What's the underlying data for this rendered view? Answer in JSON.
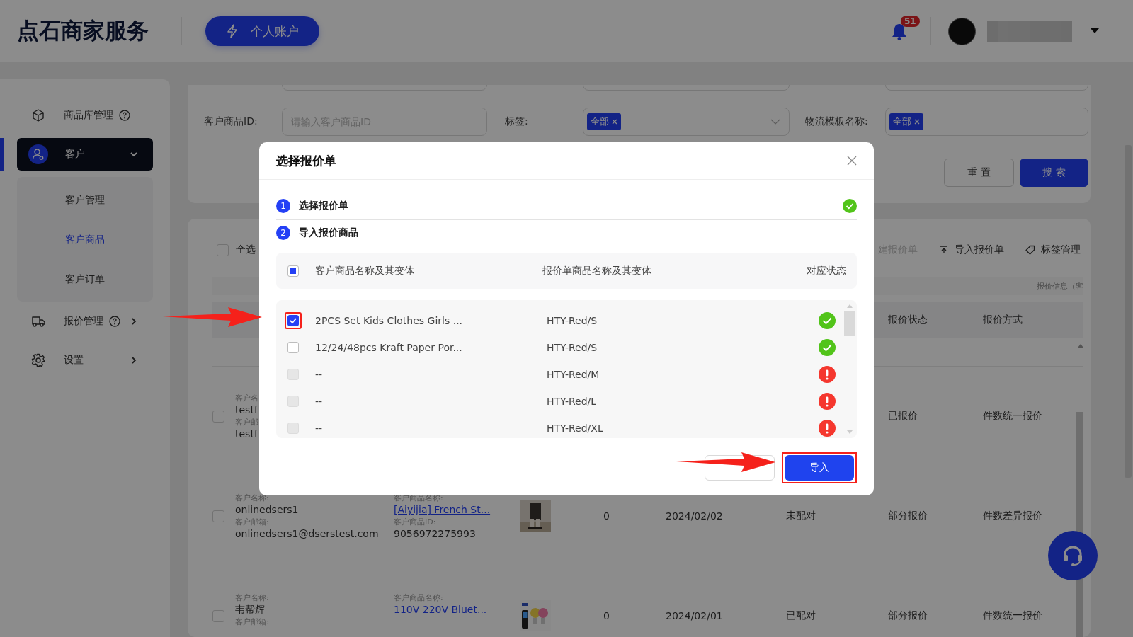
{
  "header": {
    "logo": "点石商家服务",
    "account_button": "个人账户",
    "notifications": {
      "count": "51"
    }
  },
  "sidebar": {
    "items": [
      {
        "label": "商品库管理",
        "help": true,
        "selected": false
      },
      {
        "label": "客户",
        "selected": true,
        "expanded": true,
        "children": [
          {
            "label": "客户管理",
            "selected": false
          },
          {
            "label": "客户商品",
            "selected": true
          },
          {
            "label": "客户订单",
            "selected": false
          }
        ]
      },
      {
        "label": "报价管理",
        "help": true,
        "selected": false,
        "expanded": false
      },
      {
        "label": "设置",
        "selected": false,
        "expanded": false
      }
    ]
  },
  "filters": [
    {
      "kind": "input",
      "label": "客户商品ID:",
      "placeholder": "请输入客户商品ID"
    },
    {
      "kind": "select",
      "label": "标签:",
      "tags": [
        "全部"
      ]
    },
    {
      "kind": "tags",
      "label": "物流模板名称:",
      "tags": [
        "全部"
      ]
    }
  ],
  "filter_buttons": [
    {
      "kind": "default",
      "label": "重 置"
    },
    {
      "kind": "primary",
      "label": "搜 索"
    }
  ],
  "toolbar": {
    "select_all": {
      "label": "全选",
      "checked": false
    },
    "actions": [
      {
        "label": "建报价单",
        "disabled": true
      },
      {
        "label": "导入报价单",
        "disabled": false
      },
      {
        "label": "标签管理",
        "disabled": false
      }
    ]
  },
  "table": {
    "caption": "报价信息（客",
    "columns": [
      "报价状态",
      "报价方式"
    ],
    "rows": [
      {
        "checked": false,
        "customer": {
          "name_label": "客户名",
          "name": "testf",
          "email_label": "客户邮",
          "email": "testf"
        },
        "quote_status": "已报价",
        "quote_method": "件数统一报价"
      },
      {
        "checked": false,
        "customer": {
          "name_label": "客户名称:",
          "name": "onlinedsers1",
          "email_label": "客户邮箱:",
          "email": "onlinedsers1@dserstest.com"
        },
        "product": {
          "name_label": "客户商品名称:",
          "name": "[Aiyijia] French St...",
          "id_label": "客户商品ID:",
          "id": "9056972275993"
        },
        "quantity": "0",
        "date": "2024/02/02",
        "match_status": "未配对",
        "quote_status": "部分报价",
        "quote_method": "件数差异报价"
      },
      {
        "checked": false,
        "customer": {
          "name_label": "客户名称:",
          "name": "韦帮辉",
          "email_label": "客户邮箱:"
        },
        "product": {
          "name_label": "客户商品名称:",
          "name": "110V 220V Bluet..."
        },
        "quantity": "0",
        "date": "2024/02/01",
        "match_status": "已配对",
        "quote_status": "部分报价",
        "quote_method": "件数统一报价"
      }
    ]
  },
  "dialog": {
    "title": "选择报价单",
    "steps": [
      {
        "number": "1",
        "label": "选择报价单",
        "done": true
      },
      {
        "number": "2",
        "label": "导入报价商品",
        "done": false
      }
    ],
    "table": {
      "indeterminate": true,
      "columns": [
        "客户商品名称及其变体",
        "报价单商品名称及其变体",
        "对应状态"
      ],
      "rows": [
        {
          "checked": true,
          "disabled": false,
          "highlighted": true,
          "name": "2PCS Set Kids Clothes Girls ...",
          "quote_item": "HTY-Red/S",
          "kind": "matched"
        },
        {
          "checked": false,
          "disabled": false,
          "highlighted": false,
          "name": "12/24/48pcs Kraft Paper Por...",
          "quote_item": "HTY-Red/S",
          "kind": "matched"
        },
        {
          "checked": false,
          "disabled": true,
          "highlighted": false,
          "name": "--",
          "quote_item": "HTY-Red/M",
          "kind": "unmatched"
        },
        {
          "checked": false,
          "disabled": true,
          "highlighted": false,
          "name": "--",
          "quote_item": "HTY-Red/L",
          "kind": "unmatched"
        },
        {
          "checked": false,
          "disabled": true,
          "highlighted": false,
          "name": "--",
          "quote_item": "HTY-Red/XL",
          "kind": "unmatched"
        }
      ]
    },
    "import_button": {
      "label": "导入",
      "highlighted": true
    }
  }
}
